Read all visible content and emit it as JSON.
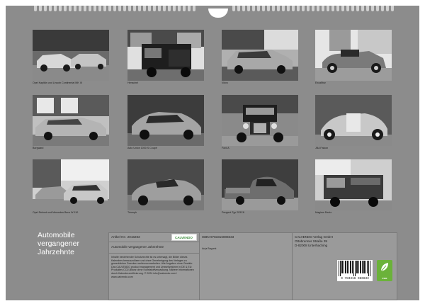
{
  "calendar": {
    "title_lines": [
      "Automobile",
      "vergangener",
      "Jahrzehnte"
    ],
    "photos": [
      {
        "caption": "Opel Kapitän und Lincoln Continental MK III"
      },
      {
        "caption": "Henschel"
      },
      {
        "caption": "Volvo"
      },
      {
        "caption": "Excalibur"
      },
      {
        "caption": "Borgward"
      },
      {
        "caption": "Auto Union 1000 S Coupé"
      },
      {
        "caption": "Ford A"
      },
      {
        "caption": "JBA Falcon"
      },
      {
        "caption": "Opel Rekord und Mercedes Benz W 110"
      },
      {
        "caption": "Triumph"
      },
      {
        "caption": "Peugeot Typ 203C8"
      },
      {
        "caption": "Magirus Deutz"
      }
    ],
    "info": {
      "article_label": "Artikel-Nr.: 2016283",
      "isbn": "ISBN 9783316086633",
      "product_title": "Automobile vergangener Jahrzehnte",
      "author": "Anja Bagunk",
      "publisher_lines": [
        "CALVENDO Verlag GmbH",
        "Ottobrunner Straße 39",
        "D-82008 Unterhaching"
      ],
      "logo": "CALVENDO",
      "description": "Inhalte bestehender Schutzrechte ist es untersagt, die Bilder dieses Kalenders herauszulösen und ohne Genehmigung des Verlages zu gewerblichen Zwecken weiterzuverarbeiten. Alle Angaben ohne Gewähr. Das CALVENDO product management und Umweltzeichen in DE & EU: Produktes CO2-Bilanz ohne Kunststoffverpackung. Nähere Informationen durch Kalenderzertifizierung. © 2024 info@calvendo.com / www.calvendo.com",
      "barcode_number": "9 783316 086633",
      "eco_label": "eco"
    }
  }
}
